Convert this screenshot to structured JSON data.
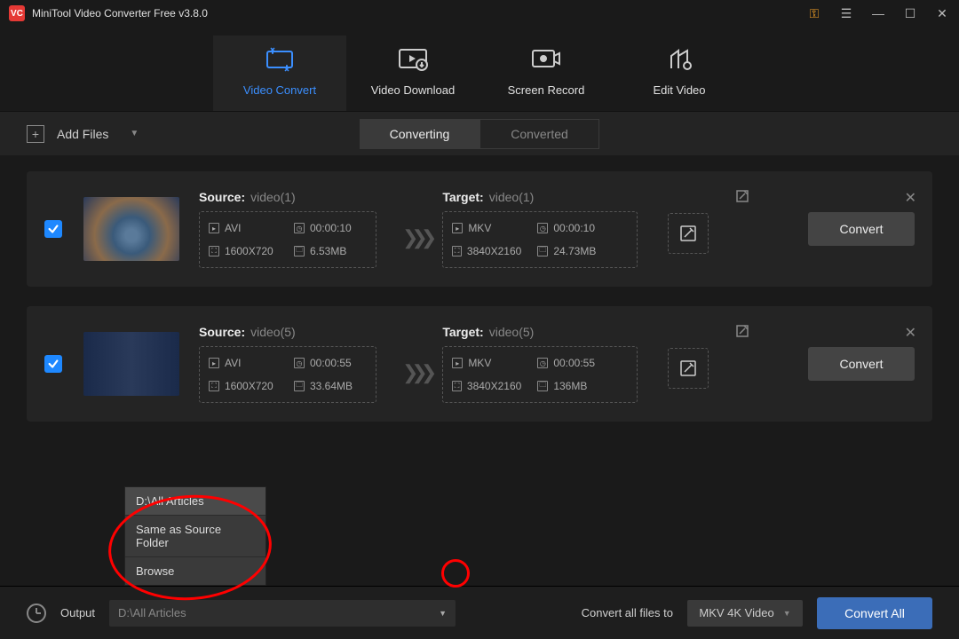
{
  "app": {
    "title": "MiniTool Video Converter Free v3.8.0"
  },
  "nav": {
    "tabs": [
      {
        "label": "Video Convert"
      },
      {
        "label": "Video Download"
      },
      {
        "label": "Screen Record"
      },
      {
        "label": "Edit Video"
      }
    ]
  },
  "toolbar": {
    "add_files": "Add Files",
    "seg_converting": "Converting",
    "seg_converted": "Converted"
  },
  "items": [
    {
      "source_label": "Source:",
      "source_name": "video(1)",
      "target_label": "Target:",
      "target_name": "video(1)",
      "src_format": "AVI",
      "src_duration": "00:00:10",
      "src_res": "1600X720",
      "src_size": "6.53MB",
      "tgt_format": "MKV",
      "tgt_duration": "00:00:10",
      "tgt_res": "3840X2160",
      "tgt_size": "24.73MB",
      "convert": "Convert"
    },
    {
      "source_label": "Source:",
      "source_name": "video(5)",
      "target_label": "Target:",
      "target_name": "video(5)",
      "src_format": "AVI",
      "src_duration": "00:00:55",
      "src_res": "1600X720",
      "src_size": "33.64MB",
      "tgt_format": "MKV",
      "tgt_duration": "00:00:55",
      "tgt_res": "3840X2160",
      "tgt_size": "136MB",
      "convert": "Convert"
    }
  ],
  "popup": {
    "opt1": "D:\\All Articles",
    "opt2": "Same as Source Folder",
    "opt3": "Browse"
  },
  "bottom": {
    "output_label": "Output",
    "output_path": "D:\\All Articles",
    "convert_all_label": "Convert all files to",
    "format": "MKV 4K Video",
    "convert_all_btn": "Convert All"
  }
}
